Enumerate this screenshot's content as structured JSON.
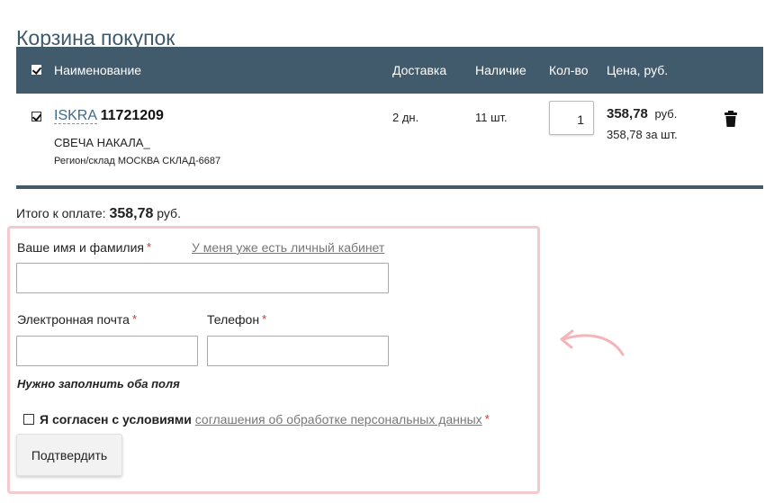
{
  "page": {
    "title": "Корзина покупок"
  },
  "cart": {
    "header": {
      "select_all_checked": true,
      "name": "Наименование",
      "delivery": "Доставка",
      "availability": "Наличие",
      "quantity": "Кол-во",
      "price": "Цена, руб."
    },
    "item": {
      "checked": true,
      "brand": "ISKRA",
      "article": "11721209",
      "name": "СВЕЧА НАКАЛА_",
      "region": "Регион/склад МОСКВА СКЛАД-6687",
      "delivery": "2 дн.",
      "availability": "11 шт.",
      "quantity": "1",
      "price": "358,78",
      "currency": "руб.",
      "unit_price": "358,78 за шт.",
      "delete_icon": "trash-icon"
    },
    "total": {
      "label": "Итого к оплате:",
      "amount": "358,78",
      "currency": "руб."
    }
  },
  "form": {
    "name_label": "Ваше имя и фамилия",
    "account_link": "У меня уже есть личный кабинет",
    "email_label": "Электронная почта",
    "phone_label": "Телефон",
    "required_mark": "*",
    "hint": "Нужно заполнить оба поля",
    "agree_checked": false,
    "agree_text": "Я согласен с условиями",
    "agree_link": "соглашения об обработке персональных данных",
    "submit": "Подтвердить"
  },
  "colors": {
    "header_bg": "#415b6c",
    "title": "#3d5a6c",
    "brand_link": "#3f6b86",
    "required": "#d0312d",
    "highlight_frame": "#f5c9cd",
    "arrow": "#f3b5ba"
  }
}
